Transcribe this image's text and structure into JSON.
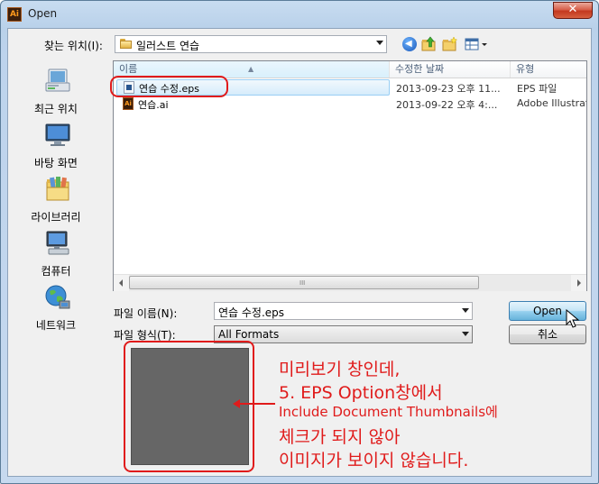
{
  "window": {
    "title": "Open",
    "app_icon_text": "Ai",
    "close_glyph": "✕"
  },
  "toolbar": {
    "look_in_label": "찾는 위치(I):",
    "look_in_value": "일러스트 연습",
    "icons": [
      "back-icon",
      "up-folder-icon",
      "new-folder-icon",
      "views-menu-icon"
    ]
  },
  "places": [
    {
      "label": "최근 위치",
      "icon": "recent-places-icon"
    },
    {
      "label": "바탕 화면",
      "icon": "desktop-icon"
    },
    {
      "label": "라이브러리",
      "icon": "libraries-icon"
    },
    {
      "label": "컴퓨터",
      "icon": "computer-icon"
    },
    {
      "label": "네트워크",
      "icon": "network-icon"
    }
  ],
  "file_list": {
    "columns": {
      "name": "이름",
      "date": "수정한 날짜",
      "type": "유형"
    },
    "rows": [
      {
        "name": "연습 수정.eps",
        "date": "2013-09-23 오후 11...",
        "type": "EPS 파일",
        "icon": "eps-file-icon",
        "selected": true
      },
      {
        "name": "연습.ai",
        "date": "2013-09-22 오후 4:...",
        "type": "Adobe Illustrat",
        "icon": "ai-file-icon",
        "selected": false
      }
    ],
    "scroll_grip": "III"
  },
  "form": {
    "filename_label": "파일 이름(N):",
    "filename_value": "연습 수정.eps",
    "filetype_label": "파일 형식(T):",
    "filetype_value": "All Formats"
  },
  "buttons": {
    "open": "Open",
    "cancel": "취소"
  },
  "annotation": {
    "color": "#e01b1b",
    "lines": [
      "미리보기 창인데,",
      "5. EPS Option창에서",
      "Include Document Thumbnails에",
      "체크가 되지 않아",
      "이미지가 보이지 않습니다."
    ]
  }
}
